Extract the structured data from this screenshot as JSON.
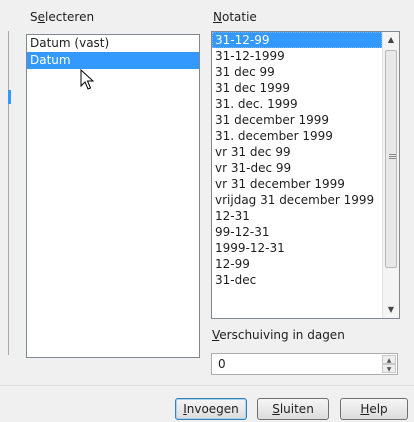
{
  "select": {
    "label_prefix": "S",
    "label_u": "e",
    "label_rest": "lecteren",
    "items": [
      "Datum (vast)",
      "Datum"
    ]
  },
  "format": {
    "label_u": "N",
    "label_rest": "otatie",
    "items": [
      "31-12-99",
      "31-12-1999",
      "31 dec 99",
      "31 dec 1999",
      "31. dec. 1999",
      "31 december 1999",
      "31. december 1999",
      "vr 31 dec 99",
      "vr 31-dec 99",
      "vr 31 december 1999",
      "vrijdag 31 december 1999",
      "12-31",
      "99-12-31",
      "1999-12-31",
      "12-99",
      "31-dec"
    ]
  },
  "shift": {
    "label_u": "V",
    "label_rest": "erschuiving in dagen",
    "value": "0"
  },
  "buttons": {
    "insert": {
      "u": "I",
      "rest": "nvoegen"
    },
    "close": {
      "u": "S",
      "rest": "luiten"
    },
    "help": {
      "u": "H",
      "rest": "elp"
    }
  }
}
